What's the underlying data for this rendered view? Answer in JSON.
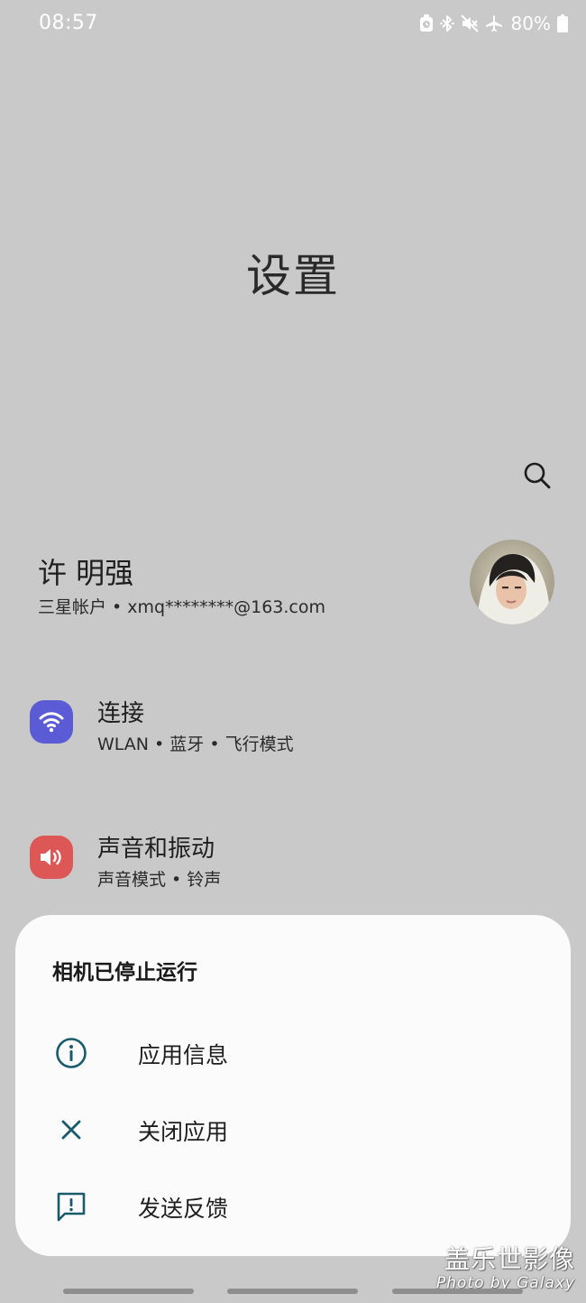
{
  "status_bar": {
    "time": "08:57",
    "battery": "80%",
    "icons": [
      "alarm-icon",
      "bluetooth-icon",
      "mute-icon",
      "airplane-mode-icon",
      "battery-icon"
    ]
  },
  "page": {
    "title": "设置",
    "search_icon": "search-icon"
  },
  "account": {
    "name": "许 明强",
    "subtitle": "三星帐户 • xmq********@163.com"
  },
  "settings": [
    {
      "title": "连接",
      "subtitle": "WLAN • 蓝牙 • 飞行模式",
      "icon": "wifi-icon",
      "color": "#5b5bd6"
    },
    {
      "title": "声音和振动",
      "subtitle": "声音模式 • 铃声",
      "icon": "speaker-icon",
      "color": "#de5757"
    }
  ],
  "dialog": {
    "title": "相机已停止运行",
    "items": [
      {
        "label": "应用信息",
        "icon": "info-icon"
      },
      {
        "label": "关闭应用",
        "icon": "close-icon"
      },
      {
        "label": "发送反馈",
        "icon": "feedback-icon"
      }
    ],
    "accent_color": "#1a5b6b"
  },
  "watermark": {
    "line1": "盖乐世影像",
    "line2": "Photo by Galaxy"
  }
}
